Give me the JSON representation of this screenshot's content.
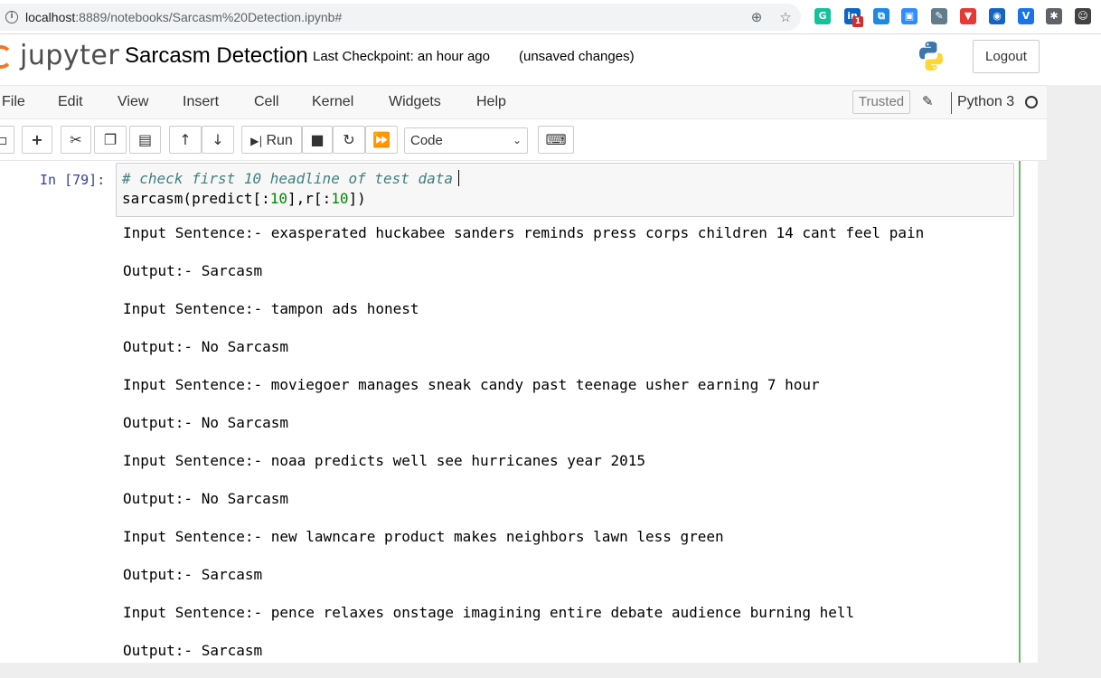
{
  "browser": {
    "url_host": "localhost",
    "url_path": ":8889/notebooks/Sarcasm%20Detection.ipynb#",
    "info_icon": "i",
    "extensions": [
      {
        "name": "grammarly-icon",
        "glyph": "G",
        "color": "#15c39a"
      },
      {
        "name": "linkedin-icon",
        "glyph": "in",
        "color": "#0a66c2",
        "badge": "1"
      },
      {
        "name": "share-icon",
        "glyph": "⧉",
        "color": "#1e88e5"
      },
      {
        "name": "zoom-icon",
        "glyph": "▣",
        "color": "#2d8cff"
      },
      {
        "name": "eyedropper-icon",
        "glyph": "✎",
        "color": "#607d8b"
      },
      {
        "name": "download-icon",
        "glyph": "▼",
        "color": "#e53935"
      },
      {
        "name": "screen-record-icon",
        "glyph": "◉",
        "color": "#1565c0"
      },
      {
        "name": "vpn-icon",
        "glyph": "V",
        "color": "#1a73e8"
      },
      {
        "name": "puzzle-icon",
        "glyph": "✱",
        "color": "#5f6368"
      },
      {
        "name": "profile-avatar-icon",
        "glyph": "☺",
        "color": "#424242"
      }
    ]
  },
  "header": {
    "logo_text": "jupyter",
    "notebook_title": "Sarcasm Detection",
    "checkpoint": "Last Checkpoint: an hour ago",
    "save_status": "(unsaved changes)",
    "logout_label": "Logout"
  },
  "menu": {
    "items": [
      "File",
      "Edit",
      "View",
      "Insert",
      "Cell",
      "Kernel",
      "Widgets",
      "Help"
    ],
    "trusted_label": "Trusted",
    "kernel_name": "Python 3"
  },
  "toolbar": {
    "run_label": "Run",
    "cell_type": "Code"
  },
  "cell": {
    "prompt": "In [79]:",
    "code_comment": "# check first 10 headline of test data",
    "code_line2_a": "sarcasm(predict[:",
    "code_line2_n1": "10",
    "code_line2_b": "],r[:",
    "code_line2_n2": "10",
    "code_line2_c": "])",
    "output": [
      "Input Sentence:- exasperated huckabee sanders reminds press corps children 14 cant feel pain",
      "Output:- Sarcasm",
      "Input Sentence:- tampon ads honest",
      "Output:- No Sarcasm",
      "Input Sentence:- moviegoer manages sneak candy past teenage usher earning 7 hour",
      "Output:- No Sarcasm",
      "Input Sentence:- noaa predicts well see hurricanes year 2015",
      "Output:- No Sarcasm",
      "Input Sentence:- new lawncare product makes neighbors lawn less green",
      "Output:- Sarcasm",
      "Input Sentence:- pence relaxes onstage imagining entire debate audience burning hell",
      "Output:- Sarcasm"
    ]
  },
  "colors": {
    "jupyter_orange": "#f37726",
    "prompt_blue": "#303f9f",
    "comment_teal": "#408080",
    "number_green": "#008800",
    "edit_mode_green": "#66bb6a"
  }
}
